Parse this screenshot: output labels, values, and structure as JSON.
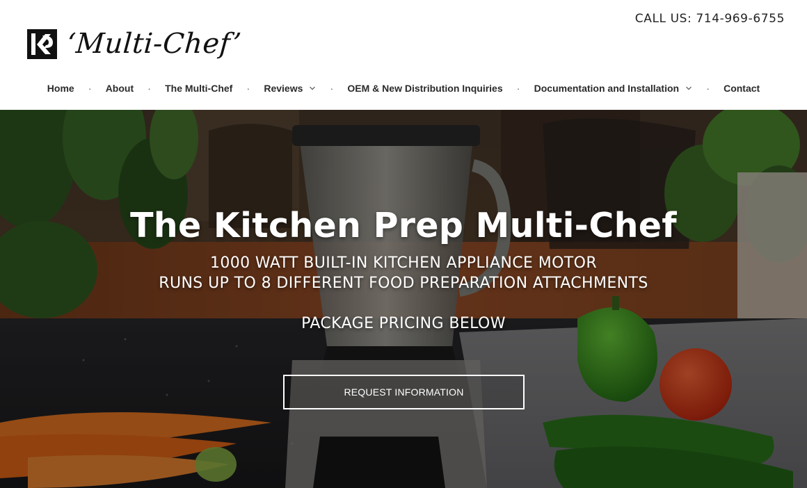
{
  "header": {
    "logo_text": "‘Multi-Chef’",
    "call_us": "CALL US: 714-969-6755"
  },
  "nav": {
    "items": [
      {
        "label": "Home",
        "has_dropdown": false
      },
      {
        "label": "About",
        "has_dropdown": false
      },
      {
        "label": "The Multi-Chef",
        "has_dropdown": false
      },
      {
        "label": "Reviews",
        "has_dropdown": true
      },
      {
        "label": "OEM & New Distribution Inquiries",
        "has_dropdown": false
      },
      {
        "label": "Documentation and Installation",
        "has_dropdown": true
      },
      {
        "label": "Contact",
        "has_dropdown": false
      }
    ],
    "separator": "·"
  },
  "hero": {
    "title": "The Kitchen Prep Multi-Chef",
    "line1": "1000 WATT BUILT-IN KITCHEN APPLIANCE MOTOR",
    "line2": "RUNS UP TO 8 DIFFERENT FOOD PREPARATION ATTACHMENTS",
    "line3": "PACKAGE PRICING BELOW",
    "button_label": "REQUEST INFORMATION"
  },
  "icons": {
    "logo": "kp-logo-icon",
    "dropdown": "chevron-down-icon"
  },
  "colors": {
    "text": "#222222",
    "hero_text": "#ffffff",
    "header_bg": "#ffffff"
  }
}
